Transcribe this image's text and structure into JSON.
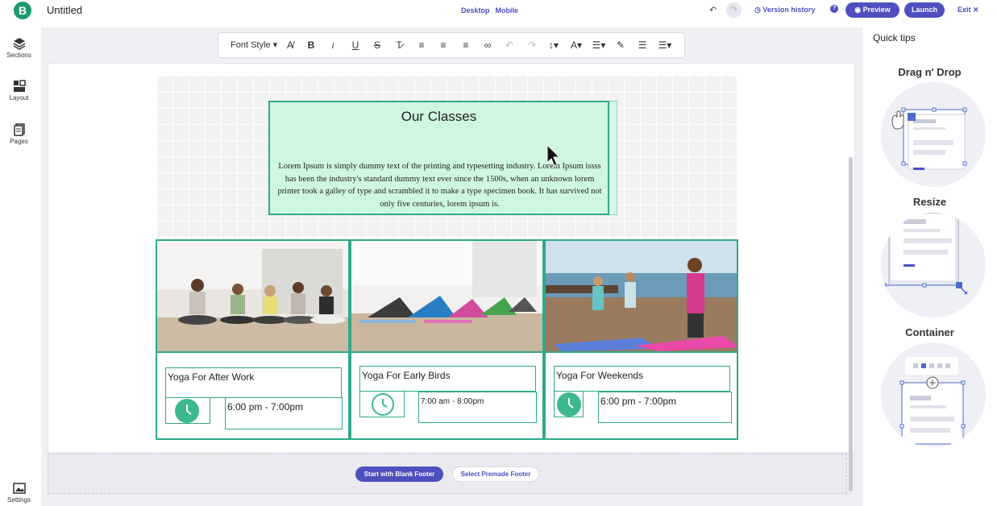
{
  "header": {
    "logo": "B",
    "title": "Untitled",
    "view_desktop": "Desktop",
    "view_mobile": "Mobile",
    "version_history": "Version history",
    "help": "?",
    "preview": "Preview",
    "launch": "Launch",
    "exit": "Exit"
  },
  "sidebar": {
    "items": [
      {
        "label": "Sections",
        "icon": "layers-icon"
      },
      {
        "label": "Layout",
        "icon": "layout-icon"
      },
      {
        "label": "Pages",
        "icon": "pages-icon"
      }
    ],
    "settings": "Settings"
  },
  "toolbar": {
    "font_style": "Font Style"
  },
  "content": {
    "section_title": "Our Classes",
    "section_body": "Lorem Ipsum is simply dummy text of the printing and typesetting industry. Lorem Ipsum issss has been the industry's standard dummy text ever since the 1500s, when an unknown lorem printer took a galley of type and scrambled it to make a type specimen book. It has survived not only five centuries, lorem ipsum is.",
    "cards": [
      {
        "title": "Yoga For After Work",
        "time": "6:00 pm - 7:00pm"
      },
      {
        "title": "Yoga For Early Birds",
        "time": "7:00 am - 8:00pm"
      },
      {
        "title": "Yoga For Weekends",
        "time": "6:00 pm - 7:00pm"
      }
    ]
  },
  "footer": {
    "blank": "Start with Blank Footer",
    "premade": "Select Premade Footer"
  },
  "tips": {
    "title": "Quick tips",
    "items": [
      "Drag n' Drop",
      "Resize",
      "Container"
    ]
  },
  "colors": {
    "accent": "#4d4fbf",
    "brand": "#1a9a6e",
    "selection": "#2fa98a",
    "selection_fill": "#cff7df"
  }
}
